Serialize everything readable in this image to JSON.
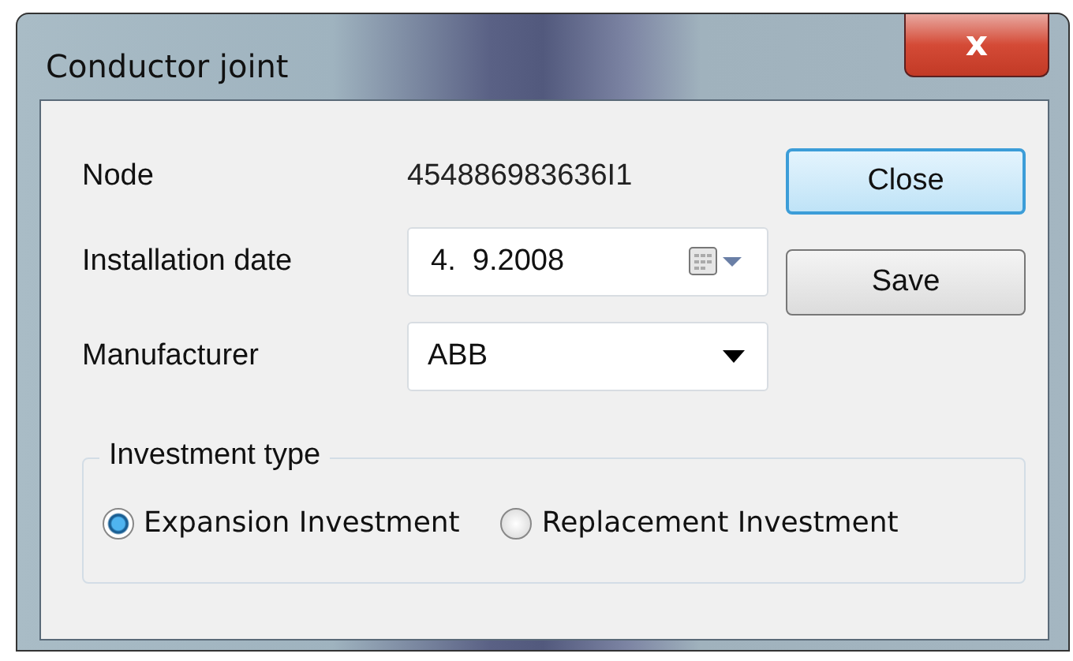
{
  "window": {
    "title": "Conductor joint",
    "close_glyph": "x"
  },
  "fields": [
    {
      "kind": "text",
      "label": "Node",
      "value": "454886983636I1"
    },
    {
      "kind": "date",
      "label": "Installation date",
      "value": "4.  9.2008"
    },
    {
      "kind": "dropdown",
      "label": "Manufacturer",
      "value": "ABB"
    }
  ],
  "buttons": [
    {
      "label": "Close",
      "focused": true
    },
    {
      "label": "Save",
      "focused": false
    }
  ],
  "investment_type": {
    "title": "Investment type",
    "options": [
      {
        "label": "Expansion Investment",
        "selected": true
      },
      {
        "label": "Replacement Investment",
        "selected": false
      }
    ]
  }
}
